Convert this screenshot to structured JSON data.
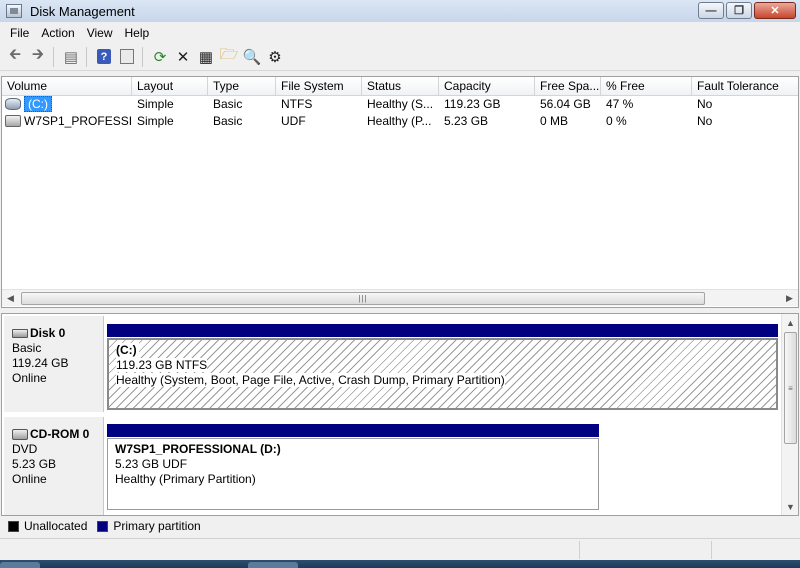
{
  "window": {
    "title": "Disk Management"
  },
  "menu": [
    "File",
    "Action",
    "View",
    "Help"
  ],
  "toolbar": {
    "buttons": [
      "back-icon",
      "forward-icon",
      "show-hide-tree-icon",
      "help-icon",
      "properties-icon",
      "refresh-icon",
      "delete-icon",
      "properties-sheet-icon",
      "open-folder-icon",
      "explore-icon",
      "wizard-icon"
    ]
  },
  "volumes": {
    "columns": [
      "Volume",
      "Layout",
      "Type",
      "File System",
      "Status",
      "Capacity",
      "Free Spa...",
      "% Free",
      "Fault Tolerance"
    ],
    "rows": [
      {
        "volume": "(C:)",
        "layout": "Simple",
        "type": "Basic",
        "fs": "NTFS",
        "status": "Healthy (S...",
        "capacity": "119.23 GB",
        "free": "56.04 GB",
        "pct": "47 %",
        "fault": "No"
      },
      {
        "volume": "W7SP1_PROFESSI...",
        "layout": "Simple",
        "type": "Basic",
        "fs": "UDF",
        "status": "Healthy (P...",
        "capacity": "5.23 GB",
        "free": "0 MB",
        "pct": "0 %",
        "fault": "No"
      }
    ]
  },
  "disks": [
    {
      "name": "Disk 0",
      "kind": "Basic",
      "size": "119.24 GB",
      "state": "Online",
      "partition": {
        "name": "(C:)",
        "size_fs": "119.23 GB NTFS",
        "status": "Healthy (System, Boot, Page File, Active, Crash Dump, Primary Partition)"
      }
    },
    {
      "name": "CD-ROM 0",
      "kind": "DVD",
      "size": "5.23 GB",
      "state": "Online",
      "partition": {
        "name": "W7SP1_PROFESSIONAL  (D:)",
        "size_fs": "5.23 GB UDF",
        "status": "Healthy (Primary Partition)"
      }
    }
  ],
  "legend": [
    {
      "label": "Unallocated",
      "color": "#000000"
    },
    {
      "label": "Primary partition",
      "color": "#000080"
    }
  ],
  "colors": {
    "primary_partition": "#000080",
    "selection": "#3399ff"
  }
}
